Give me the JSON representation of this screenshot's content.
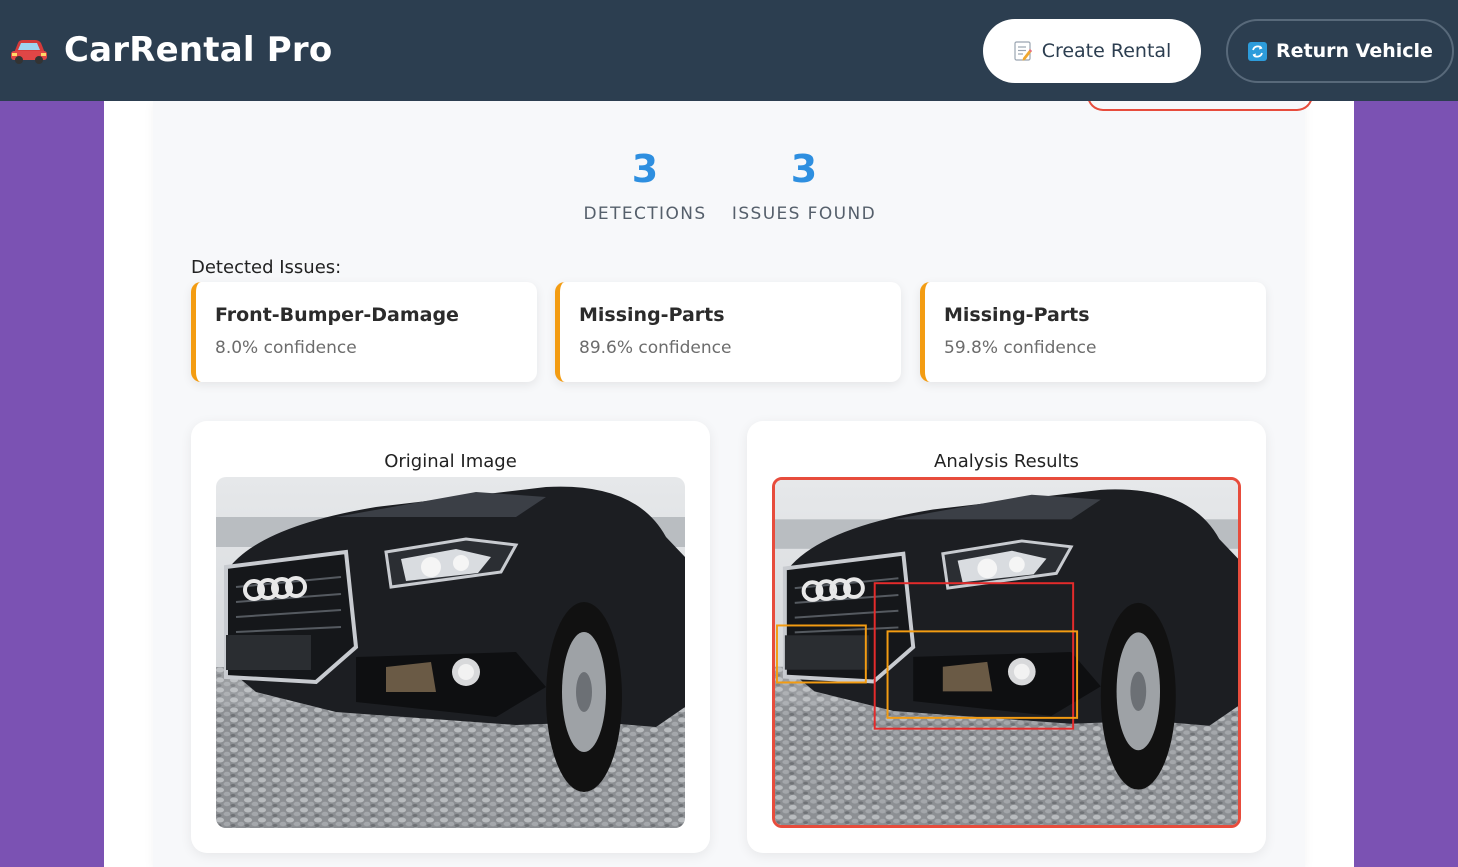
{
  "header": {
    "app_title": "CarRental Pro",
    "brand_icon": "red-car-icon",
    "create_label": "Create Rental",
    "create_icon": "memo-icon",
    "return_label": "Return Vehicle",
    "return_icon": "refresh-icon"
  },
  "stats": [
    {
      "value": "3",
      "label": "DETECTIONS"
    },
    {
      "value": "3",
      "label": "ISSUES FOUND"
    }
  ],
  "issues": {
    "title": "Detected Issues:",
    "items": [
      {
        "name": "Front-Bumper-Damage",
        "confidence": "8.0% confidence"
      },
      {
        "name": "Missing-Parts",
        "confidence": "89.6% confidence"
      },
      {
        "name": "Missing-Parts",
        "confidence": "59.8% confidence"
      }
    ]
  },
  "images": {
    "original_title": "Original Image",
    "analysis_title": "Analysis Results"
  },
  "colors": {
    "header_bg": "#2c3e50",
    "accent_blue": "#2e8fe0",
    "issue_border": "#f39c12",
    "damage_box": "#e74c3c",
    "parts_box": "#f39c12",
    "background_purple": "#7b52b3"
  }
}
